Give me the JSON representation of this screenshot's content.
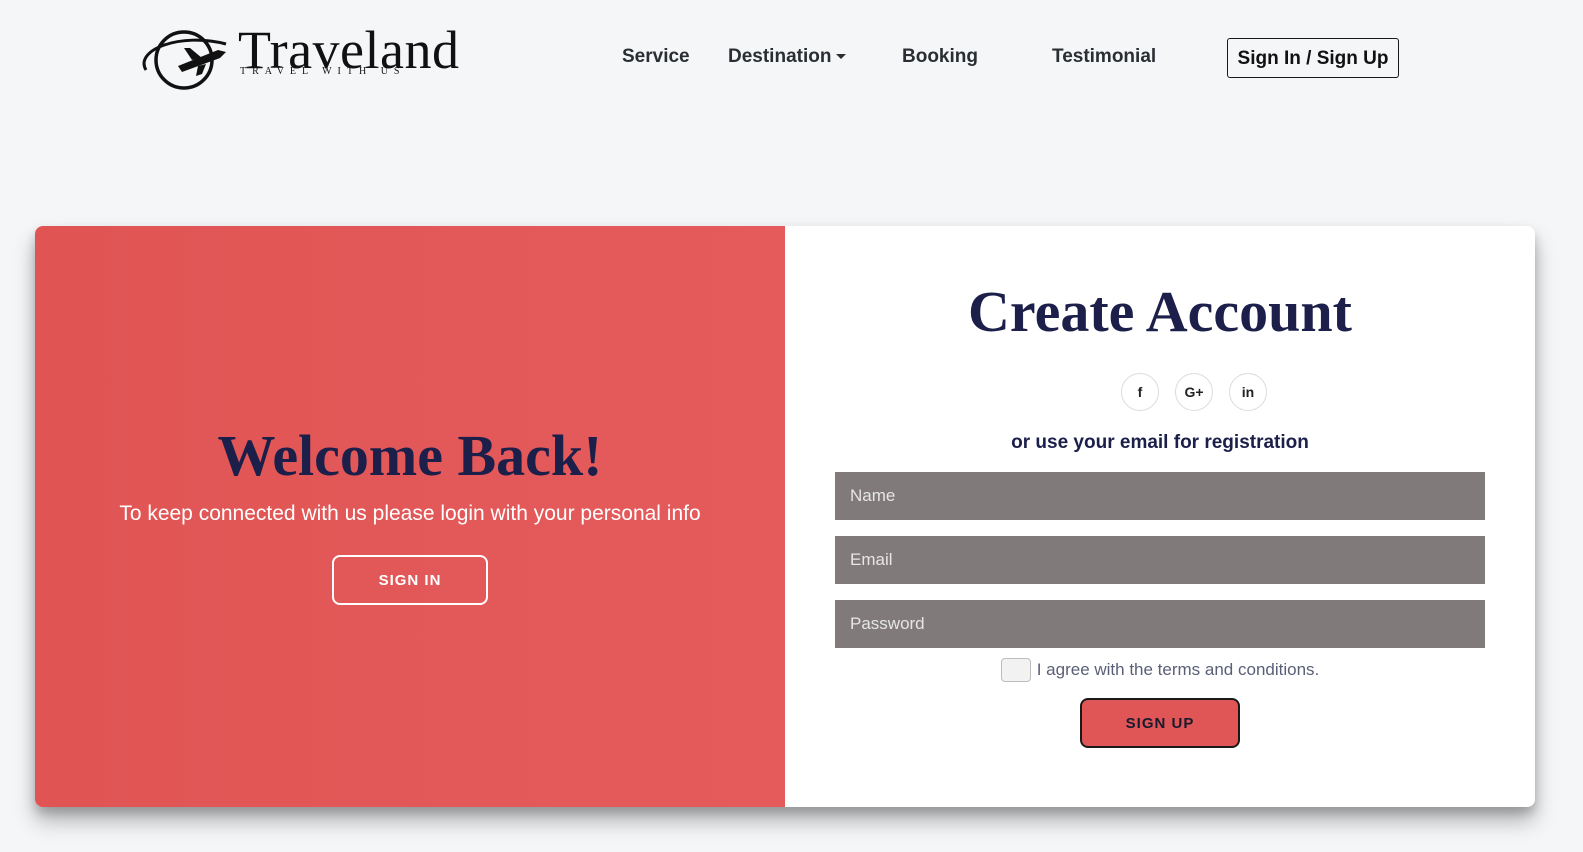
{
  "header": {
    "brand": "Traveland",
    "tagline": "TRAVEL WITH US",
    "logo_icon": "globe-plane-icon",
    "nav": [
      {
        "label": "Service"
      },
      {
        "label": "Destination",
        "has_dropdown": true
      },
      {
        "label": "Booking"
      },
      {
        "label": "Testimonial"
      }
    ],
    "auth_button": "Sign In / Sign Up"
  },
  "left_panel": {
    "title": "Welcome Back!",
    "subtitle": "To keep connected with us please login with your personal info",
    "button": "SIGN IN"
  },
  "right_panel": {
    "title": "Create Account",
    "social": [
      {
        "icon": "facebook-icon",
        "glyph": "f"
      },
      {
        "icon": "google-plus-icon",
        "glyph": "G+"
      },
      {
        "icon": "linkedin-icon",
        "glyph": "in"
      }
    ],
    "or_text": "or use your email for registration",
    "fields": {
      "name_placeholder": "Name",
      "email_placeholder": "Email",
      "password_placeholder": "Password"
    },
    "terms": "I agree with the terms and conditions.",
    "button": "SIGN UP"
  },
  "colors": {
    "accent_red": "#e05454",
    "navy": "#1b1f4a",
    "input_bg": "#817a7a"
  }
}
